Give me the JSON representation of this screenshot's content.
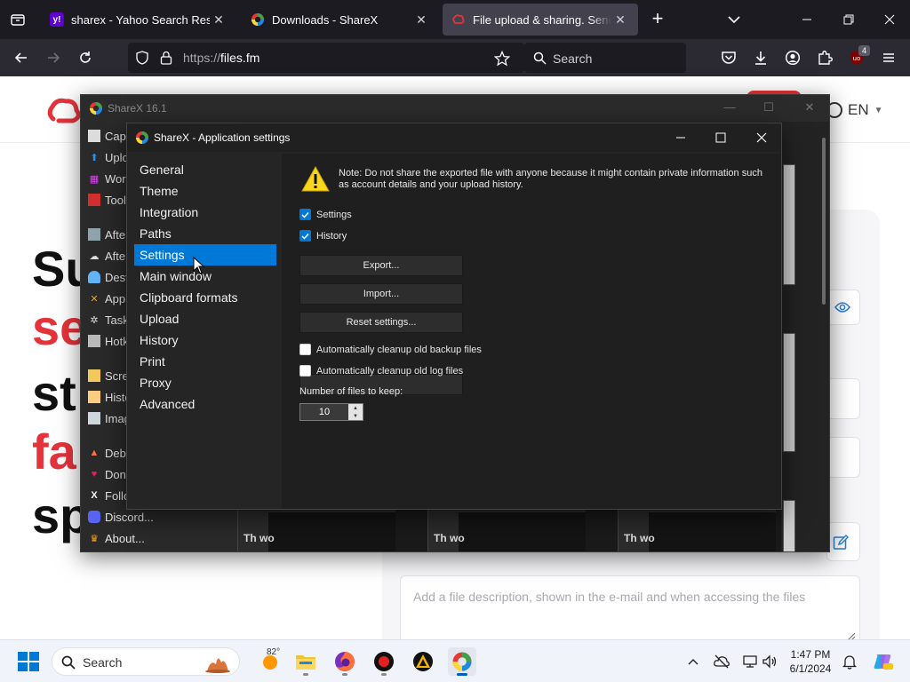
{
  "browser": {
    "tabs": [
      {
        "title": "sharex - Yahoo Search Results",
        "favicon": "yahoo",
        "favicon_color": "#6001d2",
        "active": false
      },
      {
        "title": "Downloads - ShareX",
        "favicon": "sharex",
        "active": false
      },
      {
        "title": "File upload & sharing. Send large files",
        "favicon": "filesfm",
        "active": true
      }
    ],
    "url": {
      "scheme": "https://",
      "host": "files.fm"
    },
    "search_placeholder": "Search",
    "extension_badge": "4"
  },
  "website": {
    "lang": "EN",
    "hero_lines": [
      {
        "text": "Su",
        "color": "#111111"
      },
      {
        "text": "se",
        "color": "#e5333b"
      },
      {
        "text": "st",
        "color": "#111111"
      },
      {
        "text": "fa",
        "color": "#e5333b"
      },
      {
        "text": "sp",
        "color": "#111111"
      }
    ],
    "description_placeholder": "Add a file description, shown in the e-mail and when accessing the files",
    "brand_color": "#e5333b"
  },
  "sharex_main": {
    "title": "ShareX 16.1",
    "menu": [
      {
        "label": "Capture",
        "icon": "capture-icon"
      },
      {
        "label": "Upload",
        "icon": "upload-icon"
      },
      {
        "label": "Workflows",
        "icon": "workflows-icon"
      },
      {
        "label": "Tools",
        "icon": "tools-icon"
      },
      {
        "label": "After capture tasks",
        "icon": "after-capture-icon"
      },
      {
        "label": "After upload tasks",
        "icon": "after-upload-icon"
      },
      {
        "label": "Destinations",
        "icon": "destinations-icon"
      },
      {
        "label": "Application settings...",
        "icon": "application-settings-icon"
      },
      {
        "label": "Task settings...",
        "icon": "task-settings-icon"
      },
      {
        "label": "Hotkey settings...",
        "icon": "hotkey-settings-icon"
      },
      {
        "label": "Screenshots folder...",
        "icon": "screenshots-folder-icon"
      },
      {
        "label": "History...",
        "icon": "history-icon"
      },
      {
        "label": "Image history...",
        "icon": "image-history-icon"
      },
      {
        "label": "Debug",
        "icon": "debug-icon"
      },
      {
        "label": "Donate...",
        "icon": "donate-icon"
      },
      {
        "label": "Follow me...",
        "icon": "x-icon"
      },
      {
        "label": "Discord...",
        "icon": "discord-icon"
      },
      {
        "label": "About...",
        "icon": "about-icon"
      }
    ],
    "thumb_labels": [
      "Th wo",
      "Th wo",
      "Th wo"
    ]
  },
  "settings_dialog": {
    "title": "ShareX - Application settings",
    "nav": [
      "General",
      "Theme",
      "Integration",
      "Paths",
      "Settings",
      "Main window",
      "Clipboard formats",
      "Upload",
      "History",
      "Print",
      "Proxy",
      "Advanced"
    ],
    "selected_nav": "Settings",
    "note": "Note: Do not share the exported file with anyone because it might contain private information such as account details and your upload history.",
    "checkboxes": [
      {
        "label": "Settings",
        "checked": true
      },
      {
        "label": "History",
        "checked": true
      }
    ],
    "buttons": {
      "export": "Export...",
      "import": "Import...",
      "reset": "Reset settings..."
    },
    "cleanup": [
      {
        "label": "Automatically cleanup old backup files",
        "checked": false
      },
      {
        "label": "Automatically cleanup old log files",
        "checked": false
      }
    ],
    "files_to_keep_label": "Number of files to keep:",
    "files_to_keep_value": "10",
    "accent_color": "#0078d7"
  },
  "taskbar": {
    "search_placeholder": "Search",
    "weather_temp": "82°",
    "time": "1:47 PM",
    "date": "6/1/2024",
    "apps": [
      "widgets-icon",
      "file-explorer-icon",
      "firefox-icon",
      "obs-record-icon",
      "app-icon",
      "sharex-icon"
    ]
  }
}
